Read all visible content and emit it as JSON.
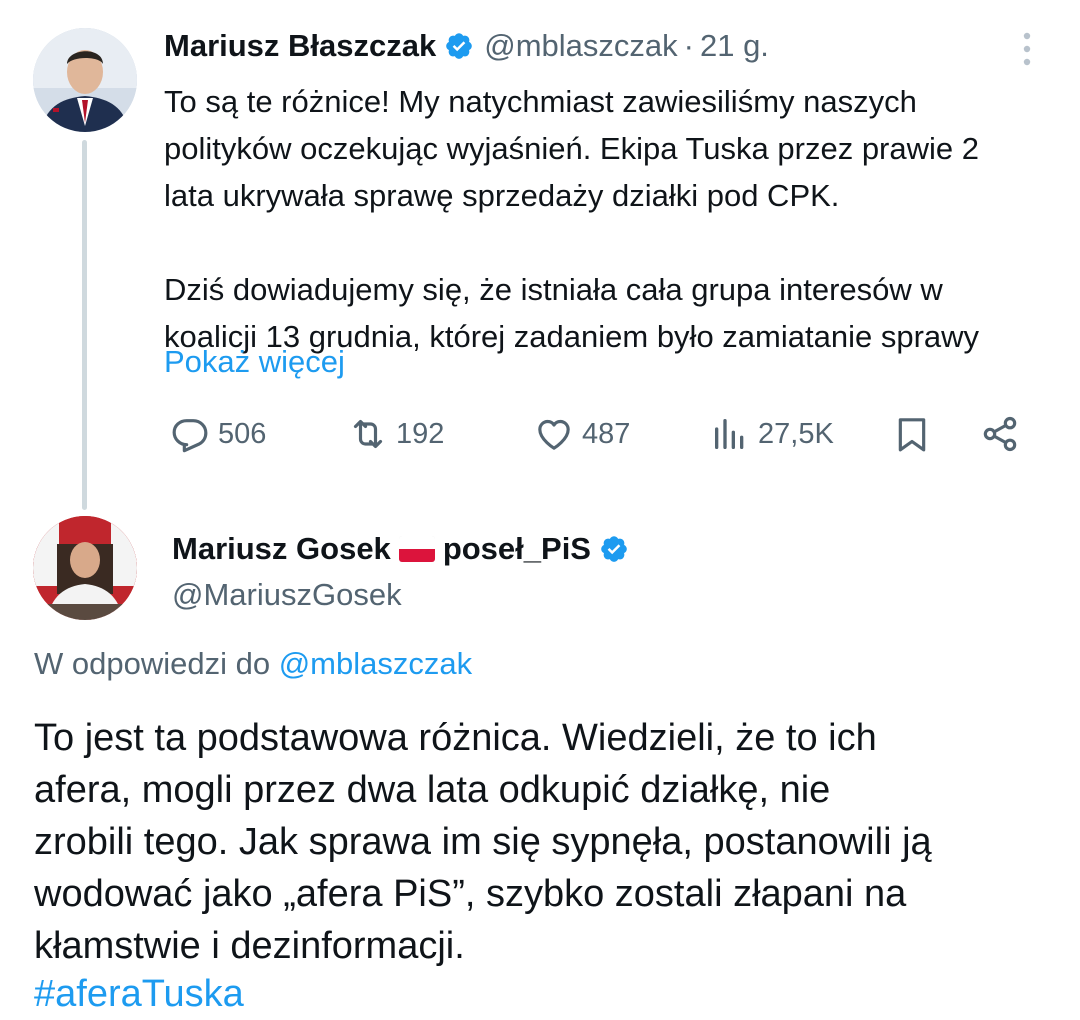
{
  "parent_tweet": {
    "author_name": "Mariusz Błaszczak",
    "handle": "@mblaszczak",
    "separator": "·",
    "time": "21 g.",
    "text_lines": [
      "To są te różnice! My natychmiast zawiesiliśmy naszych",
      "polityków oczekując wyjaśnień. Ekipa Tuska przez prawie 2",
      "lata ukrywała sprawę sprzedaży działki pod CPK."
    ],
    "text_lines_2": [
      "Dziś dowiadujemy się, że istniała cała grupa interesów w",
      "koalicji 13 grudnia, której zadaniem było zamiatanie sprawy"
    ],
    "show_more": "Pokaż więcej",
    "actions": {
      "replies": "506",
      "retweets": "192",
      "likes": "487",
      "views": "27,5K"
    },
    "icons": [
      "verified-badge-icon",
      "more-options-icon",
      "reply-icon",
      "retweet-icon",
      "like-icon",
      "views-icon",
      "bookmark-icon",
      "share-icon"
    ]
  },
  "reply_tweet": {
    "author_name": "Mariusz Gosek",
    "author_suffix": "poseł_PiS",
    "handle": "@MariuszGosek",
    "reply_to_prefix": "W odpowiedzi do",
    "reply_to_handle": "@mblaszczak",
    "text_lines": [
      "To jest ta podstawowa różnica. Wiedzieli, że to ich",
      "afera, mogli przez dwa lata odkupić działkę, nie",
      "zrobili tego. Jak sprawa im się sypnęła, postanowili ją",
      "wodować jako „afera PiS”, szybko zostali złapani na",
      "kłamstwie i dezinformacji."
    ],
    "hashtag": "#aferaTuska",
    "icons": [
      "poland-flag-icon",
      "verified-badge-icon"
    ]
  },
  "colors": {
    "text": "#0f1419",
    "secondary": "#536471",
    "accent": "#1d9bf0",
    "thread_line": "#cfd9de"
  }
}
